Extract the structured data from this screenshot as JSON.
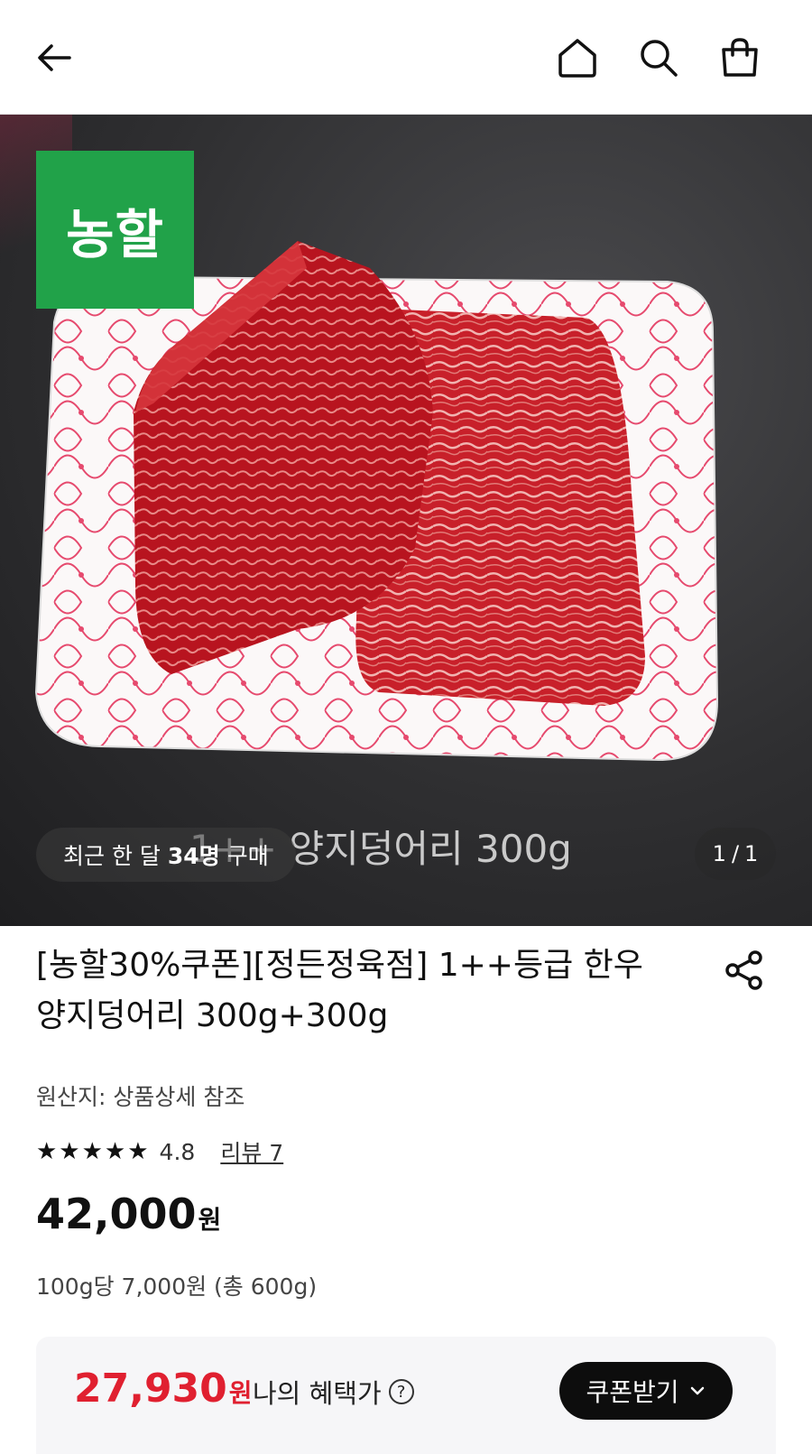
{
  "header": {
    "icons": [
      "back-arrow-icon",
      "home-icon",
      "search-icon",
      "shopping-bag-icon"
    ]
  },
  "hero": {
    "brand_logo": "농할",
    "caption": "1++ 양지덩어리 300g",
    "recent_buyers_prefix": "최근 한 달 ",
    "recent_buyers_count": "34명",
    "recent_buyers_suffix": " 구매",
    "pager_current": "1",
    "pager_sep": "/",
    "pager_total": "1"
  },
  "product": {
    "title": "[농할30%쿠폰][정든정육점] 1++등급 한우 양지덩어리 300g+300g",
    "origin": "원산지: 상품상세 참조",
    "stars": "★★★★★",
    "rating": "4.8",
    "reviews": "리뷰 7",
    "price": "42,000",
    "currency": "원",
    "unit_price": "100g당 7,000원 (총 600g)"
  },
  "benefit": {
    "price": "27,930",
    "currency": "원",
    "label": "나의 혜택가",
    "help": "?",
    "coupon_button": "쿠폰받기"
  },
  "colors": {
    "brand_green": "#21a249",
    "sale_red": "#e02030",
    "button_black": "#0d0d0d"
  }
}
